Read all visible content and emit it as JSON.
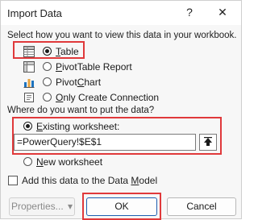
{
  "window": {
    "title": "Import Data",
    "help_glyph": "?",
    "close_glyph": "✕"
  },
  "view_section": {
    "label": "Select how you want to view this data in your workbook.",
    "options": [
      {
        "prefix": "",
        "underline": "T",
        "rest": "able",
        "selected": true,
        "icon": "table-icon"
      },
      {
        "prefix": "",
        "underline": "P",
        "rest": "ivotTable Report",
        "selected": false,
        "icon": "pivottable-icon"
      },
      {
        "prefix": "Pivot",
        "underline": "C",
        "rest": "hart",
        "selected": false,
        "icon": "pivotchart-icon"
      },
      {
        "prefix": "",
        "underline": "O",
        "rest": "nly Create Connection",
        "selected": false,
        "icon": "connection-icon"
      }
    ]
  },
  "location_section": {
    "label": "Where do you want to put the data?",
    "existing": {
      "prefix": "",
      "underline": "E",
      "rest": "xisting worksheet:",
      "selected": true
    },
    "reference_value": "=PowerQuery!$E$1",
    "new": {
      "prefix": "",
      "underline": "N",
      "rest": "ew worksheet",
      "selected": false
    }
  },
  "data_model": {
    "label_prefix": "Add this data to the Data ",
    "label_underline": "M",
    "label_rest": "odel",
    "checked": false
  },
  "buttons": {
    "properties": "Properties...",
    "properties_arrow": "▾",
    "ok": "OK",
    "cancel": "Cancel"
  },
  "colors": {
    "highlight": "#e0393b",
    "primary_border": "#1e5fb0"
  }
}
